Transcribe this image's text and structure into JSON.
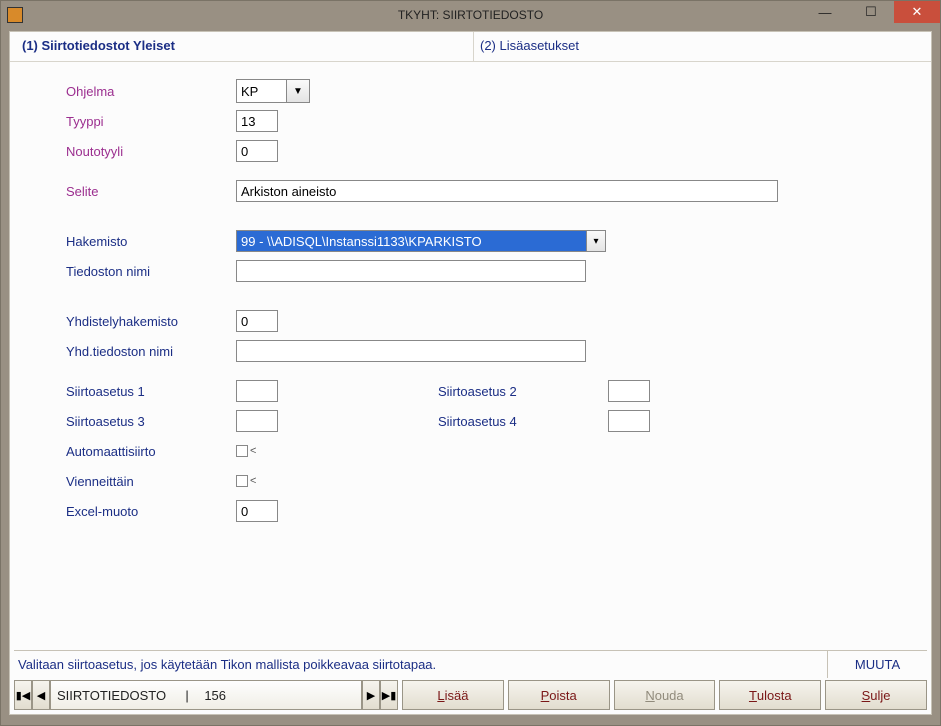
{
  "window": {
    "title": "TKYHT: SIIRTOTIEDOSTO"
  },
  "tabs": {
    "active": "(1) Siirtotiedostot Yleiset",
    "other": "(2) Lisäasetukset"
  },
  "labels": {
    "ohjelma": "Ohjelma",
    "tyyppi": "Tyyppi",
    "noutotyyli": "Noutotyyli",
    "selite": "Selite",
    "hakemisto": "Hakemisto",
    "tiedoston_nimi": "Tiedoston nimi",
    "yhdistelyhakemisto": "Yhdistelyhakemisto",
    "yhd_tiedoston_nimi": "Yhd.tiedoston nimi",
    "siirtoasetus1": "Siirtoasetus 1",
    "siirtoasetus2": "Siirtoasetus 2",
    "siirtoasetus3": "Siirtoasetus 3",
    "siirtoasetus4": "Siirtoasetus 4",
    "automaattisiirto": "Automaattisiirto",
    "vienneittain": "Vienneittäin",
    "excel_muoto": "Excel-muoto"
  },
  "values": {
    "ohjelma": "KP",
    "tyyppi": "13",
    "noutotyyli": "0",
    "selite": "Arkiston aineisto",
    "hakemisto": "99 - \\\\ADISQL\\Instanssi1133\\KPARKISTO",
    "tiedoston_nimi": "",
    "yhdistelyhakemisto": "0",
    "yhd_tiedoston_nimi": "",
    "siirtoasetus1": "",
    "siirtoasetus2": "",
    "siirtoasetus3": "",
    "siirtoasetus4": "",
    "excel_muoto": "0"
  },
  "status": {
    "hint": "Valitaan siirtoasetus, jos käytetään Tikon mallista poikkeavaa siirtotapaa.",
    "mode": "MUUTA"
  },
  "record": {
    "name": "SIIRTOTIEDOSTO",
    "sep": "|",
    "number": "156"
  },
  "buttons": {
    "lisaa_pre": "L",
    "lisaa_post": "isää",
    "poista_pre": "P",
    "poista_post": "oista",
    "nouda_pre": "N",
    "nouda_post": "ouda",
    "tulosta_pre": "T",
    "tulosta_post": "ulosta",
    "sulje_pre": "S",
    "sulje_post": "ulje"
  }
}
